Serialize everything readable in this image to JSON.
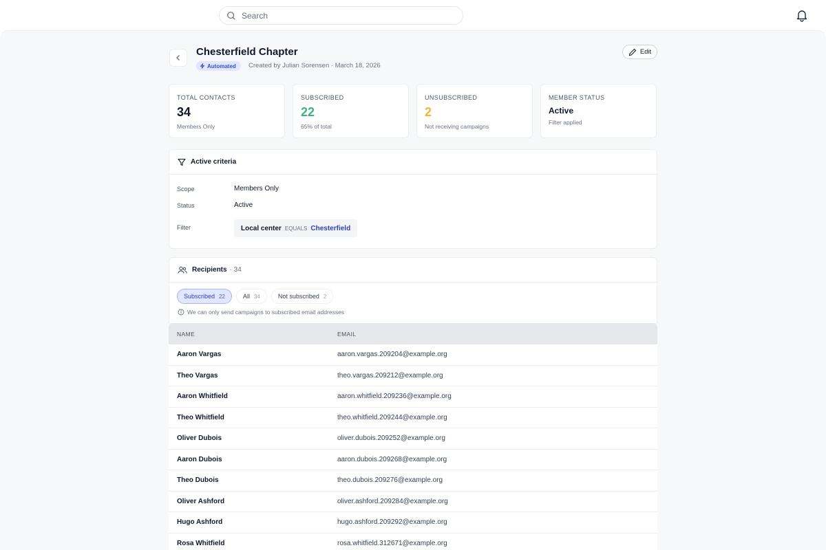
{
  "search": {
    "placeholder": "Search"
  },
  "header": {
    "title": "Chesterfield Chapter",
    "badge": "Automated",
    "meta": "Created by Julian Sorensen · March 18, 2026",
    "edit_label": "Edit"
  },
  "stats": [
    {
      "label": "TOTAL CONTACTS",
      "value": "34",
      "sub": "Members Only",
      "color": "#111827"
    },
    {
      "label": "SUBSCRIBED",
      "value": "22",
      "sub": "65% of total",
      "color": "#3fb37a"
    },
    {
      "label": "UNSUBSCRIBED",
      "value": "2",
      "sub": "Not receiving campaigns",
      "color": "#f2b632"
    },
    {
      "label": "MEMBER STATUS",
      "value": "Active",
      "sub": "Filter applied",
      "color": "#111827"
    }
  ],
  "criteria": {
    "title": "Active criteria",
    "scope_label": "Scope",
    "scope_value": "Members Only",
    "status_label": "Status",
    "status_value": "Active",
    "filter_label": "Filter",
    "filter_field": "Local center",
    "filter_op": "EQUALS",
    "filter_value": "Chesterfield"
  },
  "recipients": {
    "title": "Recipients",
    "count": "· 34",
    "tabs": [
      {
        "label": "Subscribed",
        "count": "22",
        "active": true
      },
      {
        "label": "All",
        "count": "34",
        "active": false
      },
      {
        "label": "Not subscribed",
        "count": "2",
        "active": false
      }
    ],
    "note": "We can only send campaigns to subscribed email addresses"
  },
  "table": {
    "columns": [
      "NAME",
      "EMAIL"
    ],
    "rows": [
      {
        "name": "Aaron Vargas",
        "email": "aaron.vargas.209204@example.org"
      },
      {
        "name": "Theo Vargas",
        "email": "theo.vargas.209212@example.org"
      },
      {
        "name": "Aaron Whitfield",
        "email": "aaron.whitfield.209236@example.org"
      },
      {
        "name": "Theo Whitfield",
        "email": "theo.whitfield.209244@example.org"
      },
      {
        "name": "Oliver Dubois",
        "email": "oliver.dubois.209252@example.org"
      },
      {
        "name": "Aaron Dubois",
        "email": "aaron.dubois.209268@example.org"
      },
      {
        "name": "Theo Dubois",
        "email": "theo.dubois.209276@example.org"
      },
      {
        "name": "Oliver Ashford",
        "email": "oliver.ashford.209284@example.org"
      },
      {
        "name": "Hugo Ashford",
        "email": "hugo.ashford.209292@example.org"
      },
      {
        "name": "Rosa Whitfield",
        "email": "rosa.whitfield.312671@example.org"
      }
    ]
  }
}
